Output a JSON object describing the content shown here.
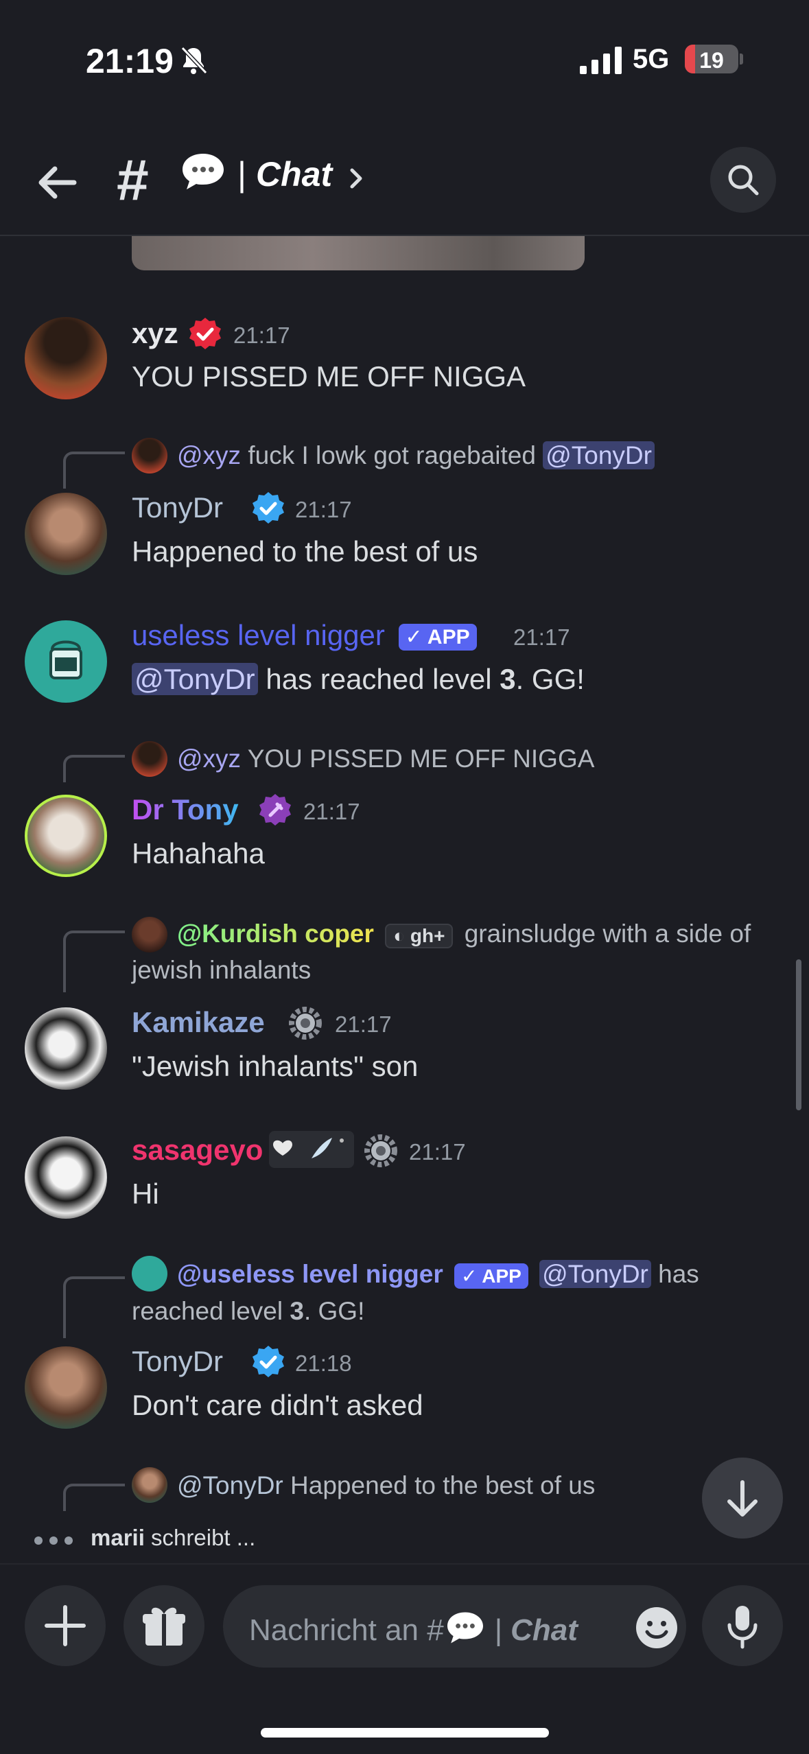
{
  "status_bar": {
    "time": "21:19",
    "network": "5G",
    "battery": "19",
    "battery_level": 0.19
  },
  "header": {
    "hash": "#",
    "channel_sep": "|",
    "channel_name": "Chat"
  },
  "messages": [
    {
      "username": "xyz",
      "username_color": "#e8e9ec",
      "time": "21:17",
      "text": "YOU PISSED ME OFF NIGGA"
    },
    {
      "reply": {
        "name": "@xyz",
        "text": "fuck I lowk got ragebaited",
        "mention": "@TonyDr"
      },
      "username": "TonyDr",
      "username_color": "#b5c4d6",
      "time": "21:17",
      "text": "Happened to the best of us"
    },
    {
      "username": "useless level nigger",
      "username_color": "#5865f2",
      "badge": "APP",
      "time": "21:17",
      "mention": "@TonyDr",
      "text_before": " has reached level ",
      "level": "3",
      "text_after": ". GG!"
    },
    {
      "reply": {
        "name": "@xyz",
        "text": "YOU PISSED ME OFF NIGGA"
      },
      "username": "Dr Tony",
      "time": "21:17",
      "text": "Hahahaha"
    },
    {
      "reply": {
        "name": "@Kurdish coper",
        "tag": "gh+",
        "text": "grainsludge with a side of",
        "text2": "jewish inhalants"
      },
      "username": "Kamikaze",
      "username_color": "#8fa6d6",
      "time": "21:17",
      "text": "\"Jewish inhalants\" son"
    },
    {
      "username": "sasageyo",
      "username_color": "#f0346e",
      "time": "21:17",
      "text": "Hi"
    },
    {
      "reply": {
        "name": "@useless level nigger",
        "badge": "APP",
        "mention": "@TonyDr",
        "text": "has",
        "text2_before": "reached level ",
        "level": "3",
        "text2_after": ". GG!"
      },
      "username": "TonyDr",
      "username_color": "#b5c4d6",
      "time": "21:18",
      "text": "Don't care didn't asked"
    },
    {
      "reply": {
        "name": "@TonyDr",
        "text": "Happened to the best of us"
      }
    }
  ],
  "typing": {
    "user": "marii",
    "text": "schreibt ..."
  },
  "composer": {
    "placeholder_prefix": "Nachricht an #",
    "placeholder_sep": "|",
    "placeholder_channel": "Chat"
  },
  "icons": {
    "back": "arrow-left-icon",
    "search": "search-icon",
    "add": "plus-icon",
    "gift": "gift-icon",
    "emoji": "emoji-icon",
    "mic": "microphone-icon",
    "scroll_down": "arrow-down-icon"
  },
  "colors": {
    "background": "#1c1d23",
    "accent": "#5865f2",
    "mention_bg": "#3c4270",
    "verified": "#3aa6f2"
  }
}
